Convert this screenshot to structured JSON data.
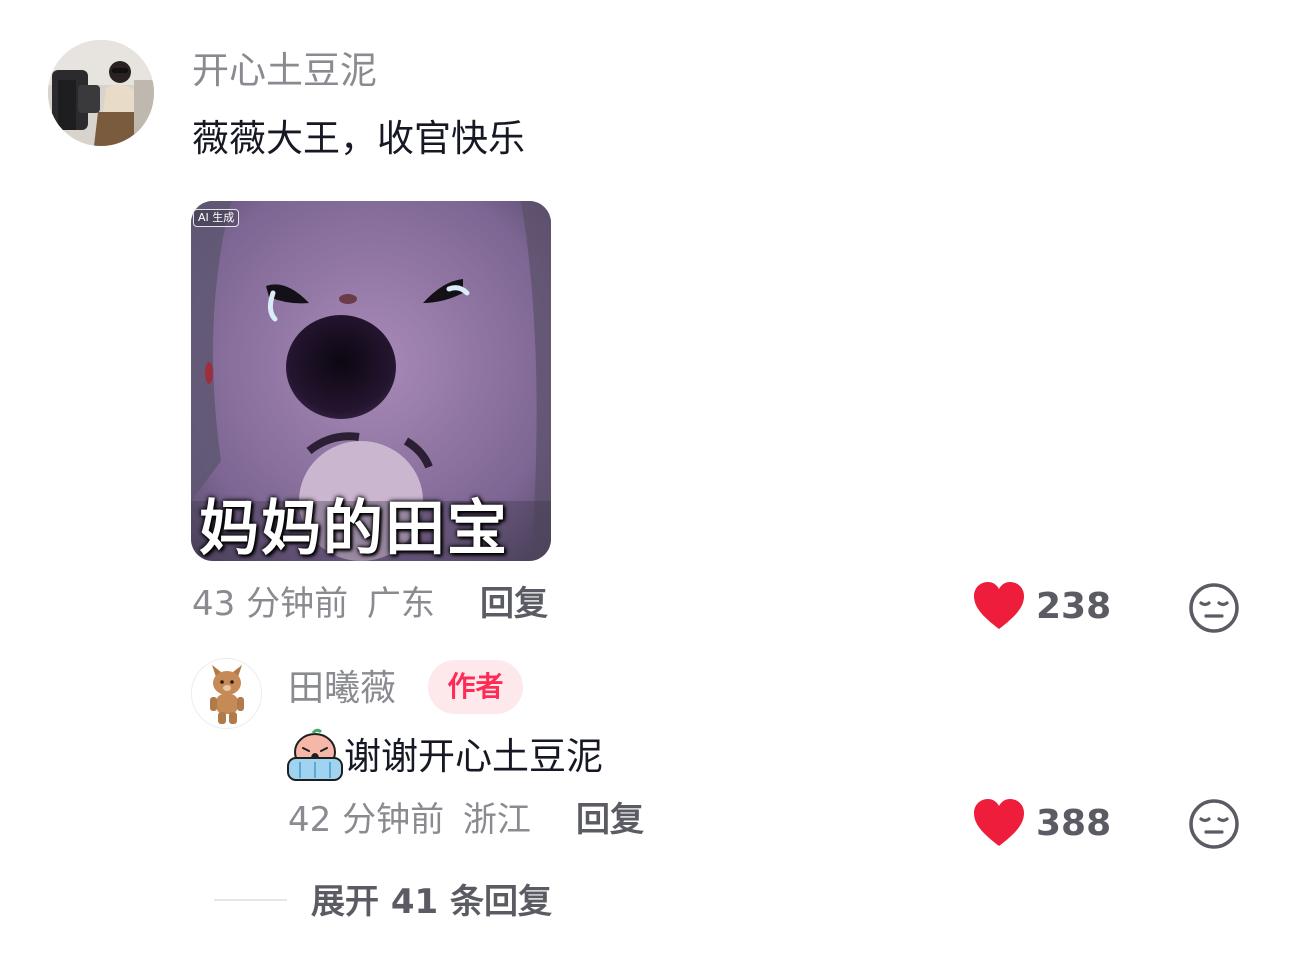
{
  "comment": {
    "username": "开心土豆泥",
    "text": "薇薇大王，收官快乐",
    "sticker": {
      "ai_label": "AI 生成",
      "caption": "妈妈的田宝"
    },
    "time": "43 分钟前",
    "location": "广东",
    "reply_label": "回复",
    "likes": "238",
    "like_icon": "heart-icon",
    "dislike_icon": "meh-face-icon"
  },
  "reply": {
    "username": "田曦薇",
    "badge": "作者",
    "text": "谢谢开心土豆泥",
    "emoji": "crying-emoji",
    "time": "42 分钟前",
    "location": "浙江",
    "reply_label": "回复",
    "likes": "388",
    "like_icon": "heart-icon",
    "dislike_icon": "meh-face-icon"
  },
  "expand": {
    "label": "展开 41 条回复"
  },
  "colors": {
    "like_red": "#fe2c55",
    "heart_red": "#ee1d3b",
    "muted_text": "#8a8b91",
    "primary_text": "#161823",
    "badge_bg": "#fde8ec"
  }
}
